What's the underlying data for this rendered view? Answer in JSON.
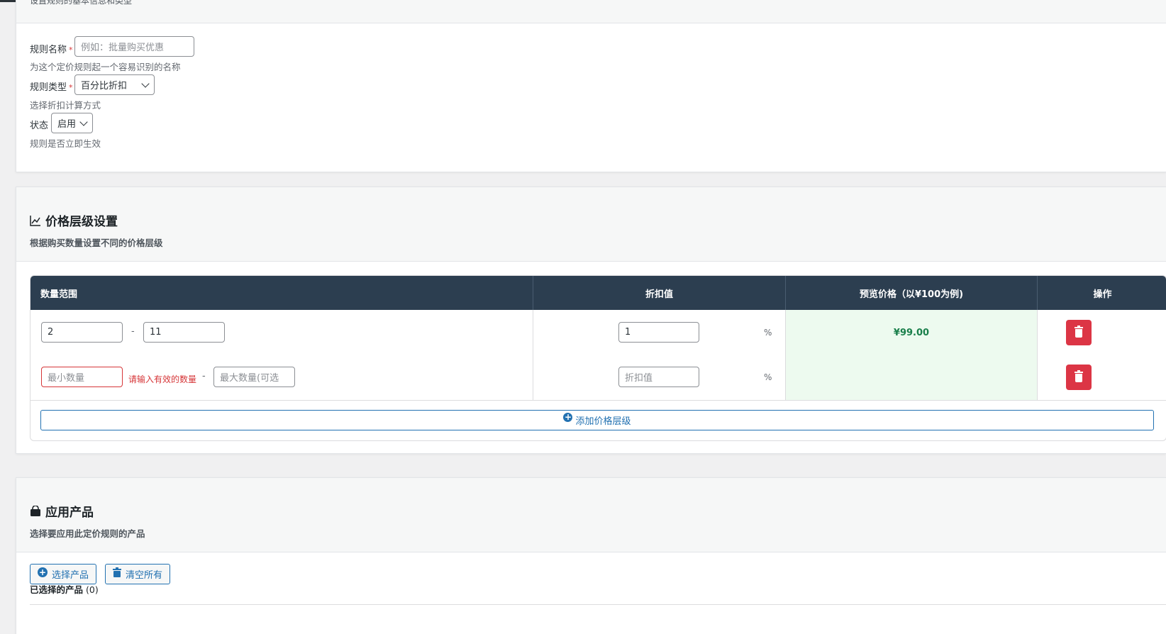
{
  "card1": {
    "subtitle": "设置规则的基本信息和类型",
    "name_label": "规则名称",
    "required_mark": "*",
    "name_placeholder": "例如：批量购买优惠",
    "name_help": "为这个定价规则起一个容易识别的名称",
    "type_label": "规则类型",
    "type_value": "百分比折扣",
    "type_help": "选择折扣计算方式",
    "status_label": "状态",
    "status_value": "启用",
    "status_help": "规则是否立即生效"
  },
  "tiers": {
    "title": "价格层级设置",
    "title_icon": "chart-line-icon",
    "subtitle": "根据购买数量设置不同的价格层级",
    "headers": {
      "range": "数量范围",
      "discount": "折扣值",
      "preview": "预览价格（以¥100为例)",
      "actions": "操作"
    },
    "rows": [
      {
        "min": "2",
        "max": "11",
        "discount": "1",
        "pct": "%",
        "preview": "¥99.00"
      },
      {
        "min_placeholder": "最小数量",
        "error": "请输入有效的数量",
        "max_placeholder": "最大数量(可选",
        "discount_placeholder": "折扣值",
        "pct": "%"
      }
    ],
    "dash": "-",
    "add_label": "添加价格层级"
  },
  "products": {
    "title": "应用产品",
    "title_icon": "shopping-bag-icon",
    "subtitle": "选择要应用此定价规则的产品",
    "select_btn": "选择产品",
    "clear_btn": "清空所有",
    "selected_label": "已选择的产品",
    "selected_count": "(0)"
  },
  "colors": {
    "header_bg": "#2c3e50",
    "danger": "#dc3545",
    "primary": "#2271b1",
    "preview_bg": "#edfaef"
  }
}
